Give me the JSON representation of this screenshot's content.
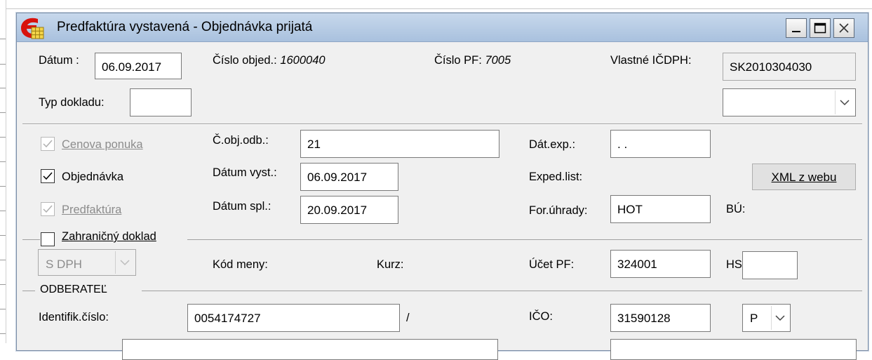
{
  "window": {
    "title": "Predfaktúra vystavená - Objednávka prijatá",
    "icon": "app-e-grid-icon",
    "controls": {
      "minimize": "_",
      "maximize": "□",
      "close": "✕"
    }
  },
  "header": {
    "datum_label": "Dátum :",
    "datum_value": "06.09.2017",
    "cislo_objed_label": "Číslo objed.:",
    "cislo_objed_value": "1600040",
    "cislo_pf_label": "Číslo PF:",
    "cislo_pf_value": "7005",
    "vlastne_icdph_label": "Vlastné IČDPH:",
    "vlastne_icdph_value": "SK2010304030",
    "typ_dokladu_label": "Typ dokladu:",
    "typ_dokladu_value": "",
    "right_combo_value": ""
  },
  "options": {
    "cenova_ponuka": {
      "label": "Cenova ponuka",
      "checked": true,
      "enabled": false
    },
    "objednavka": {
      "label": "Objednávka",
      "checked": true,
      "enabled": true
    },
    "predfaktura": {
      "label": "Predfaktúra",
      "checked": true,
      "enabled": false
    },
    "zahranicny": {
      "label": "Zahraničný doklad",
      "checked": false,
      "enabled": true
    }
  },
  "fields": {
    "c_obj_odb_label": "Č.obj.odb.:",
    "c_obj_odb_value": "21",
    "datum_vyst_label": "Dátum vyst.:",
    "datum_vyst_value": "06.09.2017",
    "datum_spl_label": "Dátum spl.:",
    "datum_spl_value": "20.09.2017",
    "dat_exp_label": "Dát.exp.:",
    "dat_exp_value": ". .",
    "exped_list_label": "Exped.list:",
    "xml_button_label": "XML z webu",
    "for_uhrady_label": "For.úhrady:",
    "for_uhrady_value": "HOT",
    "bu_label": "BÚ:",
    "dph_combo_value": "S DPH",
    "kod_meny_label": "Kód meny:",
    "kurz_label": "Kurz:",
    "ucet_pf_label": "Účet PF:",
    "ucet_pf_value": "324001",
    "hs_label": "HS:",
    "hs_value": ""
  },
  "odberatel": {
    "section_label": "ODBERATEĽ",
    "identifik_label": "Identifik.číslo:",
    "identifik_value": "0054174727",
    "slash": "/",
    "ico_label": "IČO:",
    "ico_value": "31590128",
    "p_combo_value": "P"
  }
}
